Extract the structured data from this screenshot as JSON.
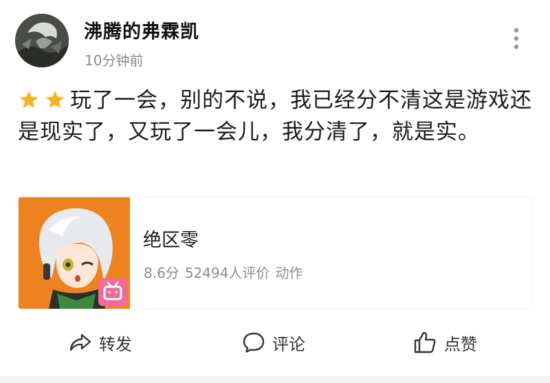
{
  "post": {
    "author": "沸腾的弗霖凯",
    "time": "10分钟前",
    "rating_stars": 2,
    "text": "玩了一会，别的不说，我已经分不清这是游戏还是现实了，又玩了一会儿，我分清了，就是实。"
  },
  "app_card": {
    "name": "绝区零",
    "score": "8.6分",
    "reviews": "52494人评价",
    "genre": "动作",
    "badge_icon": "bilibili-tv-icon"
  },
  "actions": {
    "share": "转发",
    "comment": "评论",
    "like": "点赞"
  },
  "colors": {
    "star": "#f5b324",
    "card_orange": "#f08a24",
    "badge_pink": "#f06a9a"
  }
}
